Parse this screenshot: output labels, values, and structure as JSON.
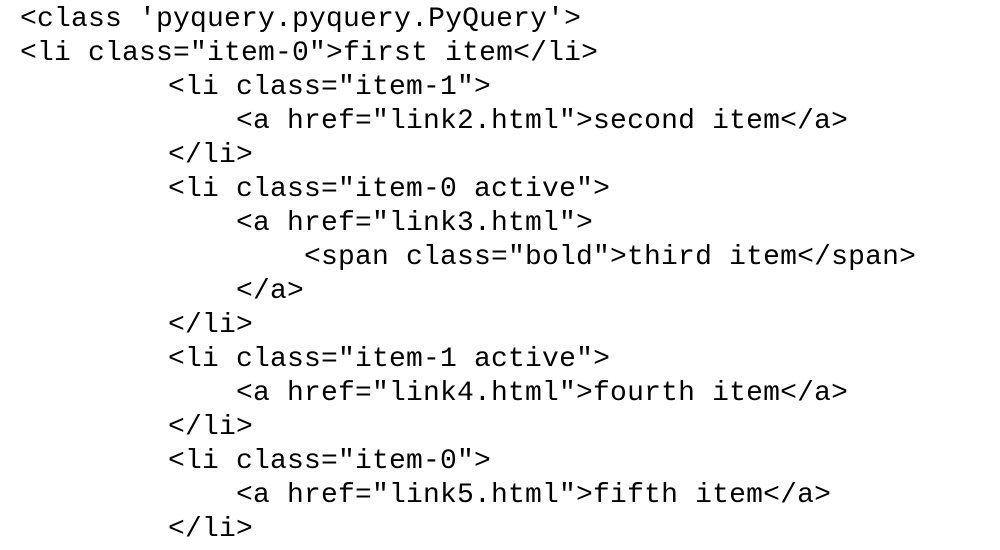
{
  "console": {
    "lines": [
      "<class 'pyquery.pyquery.PyQuery'>",
      "<li class=\"item-0\">first item</li>",
      "<li class=\"item-1\">",
      "<a href=\"link2.html\">second item</a>",
      "</li>",
      "<li class=\"item-0 active\">",
      "<a href=\"link3.html\">",
      "<span class=\"bold\">third item</span>",
      "</a>",
      "</li>",
      "<li class=\"item-1 active\">",
      "<a href=\"link4.html\">fourth item</a>",
      "</li>",
      "<li class=\"item-0\">",
      "<a href=\"link5.html\">fifth item</a>",
      "</li>"
    ]
  }
}
